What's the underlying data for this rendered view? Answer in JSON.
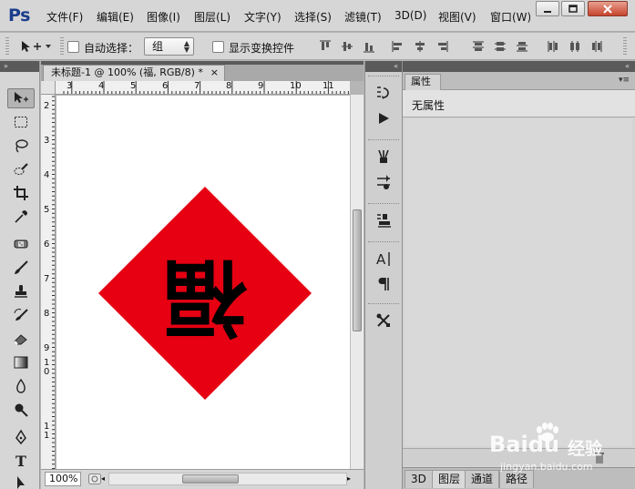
{
  "app": {
    "logo": "Ps",
    "menu": [
      "文件(F)",
      "编辑(E)",
      "图像(I)",
      "图层(L)",
      "文字(Y)",
      "选择(S)",
      "滤镜(T)",
      "3D(D)",
      "视图(V)",
      "窗口(W)"
    ]
  },
  "options_bar": {
    "auto_select_label": "自动选择：",
    "auto_select_value": "组",
    "show_transform_label": "显示变换控件"
  },
  "document": {
    "tab_title": "未标题-1 @ 100% (福, RGB/8) *",
    "tab_close": "×",
    "zoom": "100%",
    "ruler_top": [
      "3",
      "4",
      "5",
      "6",
      "7",
      "8",
      "9",
      "10",
      "11"
    ],
    "ruler_left": [
      "2",
      "3",
      "4",
      "5",
      "6",
      "7",
      "8",
      "9",
      "10",
      "11"
    ],
    "canvas_glyph": "福",
    "colors": {
      "diamond": "#e60012",
      "glyph": "#000000"
    }
  },
  "tools": [
    "move-tool",
    "marquee-tool",
    "lasso-tool",
    "quick-selection-tool",
    "crop-tool",
    "eyedropper-tool",
    "healing-brush-tool",
    "brush-tool",
    "clone-stamp-tool",
    "history-brush-tool",
    "eraser-tool",
    "gradient-tool",
    "blur-tool",
    "dodge-tool",
    "pen-tool",
    "type-tool",
    "path-selection-tool"
  ],
  "tool_labels": {
    "type": "T"
  },
  "dock_icons": [
    "history-icon",
    "actions-icon",
    "brush-presets-icon",
    "adjustments-icon",
    "tool-presets-icon",
    "clone-source-icon",
    "character-icon",
    "paragraph-icon",
    "properties-icon"
  ],
  "properties": {
    "tab_label": "属性",
    "empty_text": "无属性"
  },
  "bottom_tabs": [
    "3D",
    "图层",
    "通道",
    "路径"
  ],
  "watermark": {
    "brand": "Baidu",
    "brand_cn": "经验",
    "url": "jingyan.baidu.com"
  }
}
